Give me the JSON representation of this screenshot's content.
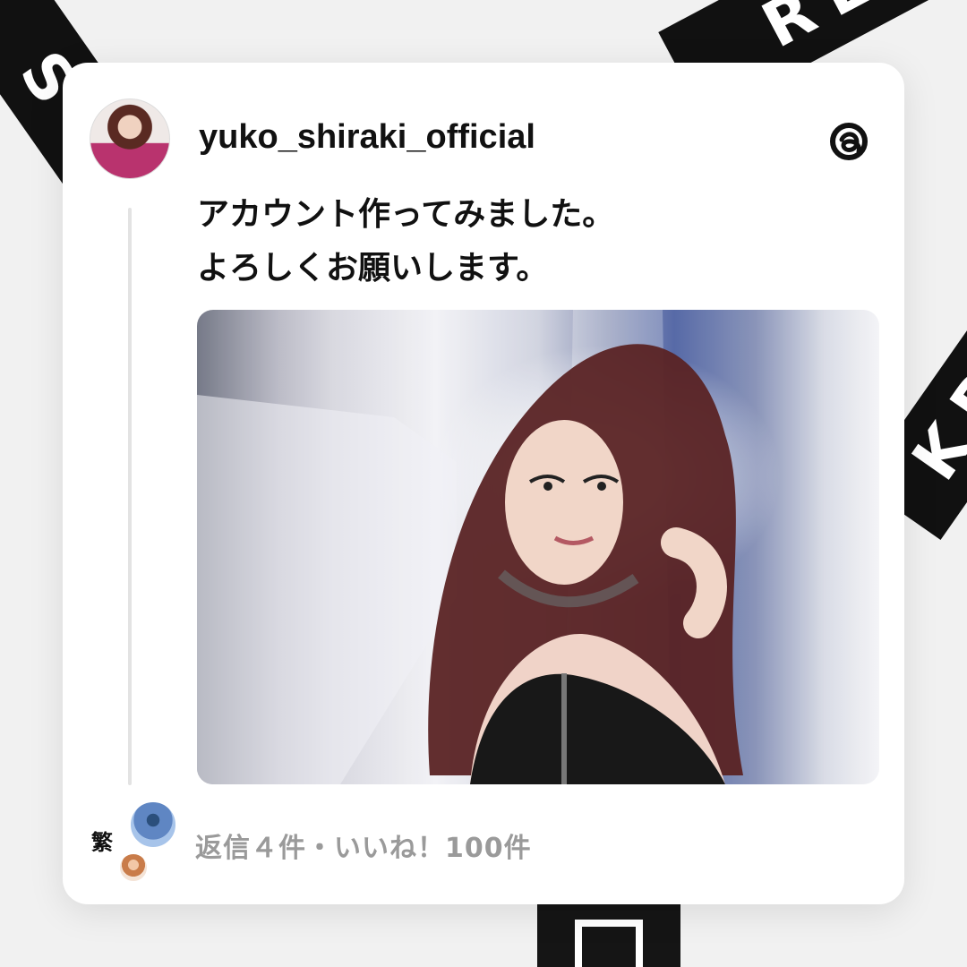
{
  "post": {
    "username": "yuko_shiraki_official",
    "text_line_1": "アカウント作ってみました。",
    "text_line_2": "よろしくお願いします。",
    "stats": "返信４件・いいね！100件"
  },
  "icons": {
    "threads": "threads-logo-icon",
    "avatar_a_glyph": "繁"
  }
}
